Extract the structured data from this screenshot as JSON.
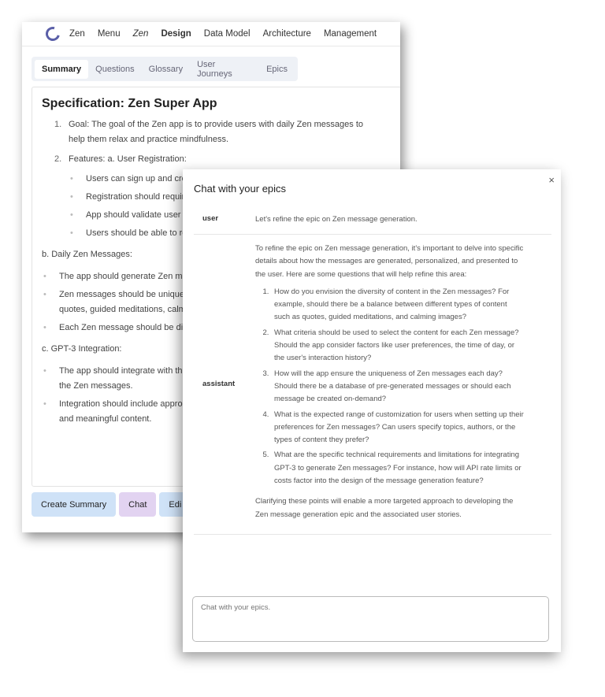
{
  "nav": {
    "items": [
      "Zen",
      "Menu",
      "Zen",
      "Design",
      "Data Model",
      "Architecture",
      "Management"
    ]
  },
  "tabs": [
    "Summary",
    "Questions",
    "Glossary",
    "User Journeys",
    "Epics"
  ],
  "spec": {
    "title": "Specification: Zen Super App",
    "items": [
      {
        "n": "1.",
        "text": "Goal: The goal of the Zen app is to provide users with daily Zen messages to help them relax and practice mindfulness."
      },
      {
        "n": "2.",
        "text": "Features: a. User Registration:"
      }
    ],
    "registration": [
      "Users can sign up and creat",
      "Registration should require email, and password.",
      "App should validate user inp password strength requirem",
      "Users should be able to reco reset process."
    ],
    "daily_heading": "b. Daily Zen Messages:",
    "daily": [
      "The app should generate Zen me",
      "Zen messages should be unique quotes, guided meditations, calm",
      "Each Zen message should be dis"
    ],
    "gpt_heading": "c. GPT-3 Integration:",
    "gpt": [
      "The app should integrate with th the Zen messages.",
      "Integration should include appro and meaningful content."
    ]
  },
  "buttons": {
    "create_summary": "Create Summary",
    "chat": "Chat",
    "edit": "Edi"
  },
  "colors": {
    "blue_button": "#cfe2f7",
    "purple_button": "#e2d3f1"
  },
  "modal": {
    "title": "Chat with your epics",
    "close": "×",
    "messages": [
      {
        "role": "user",
        "text": "Let's refine the epic on Zen message generation."
      },
      {
        "role": "assistant",
        "intro": "To refine the epic on Zen message generation, it's important to delve into specific details about how the messages are generated, personalized, and presented to the user. Here are some questions that will help refine this area:",
        "questions": [
          "How do you envision the diversity of content in the Zen messages? For example, should there be a balance between different types of content such as quotes, guided meditations, and calming images?",
          "What criteria should be used to select the content for each Zen message? Should the app consider factors like user preferences, the time of day, or the user's interaction history?",
          "How will the app ensure the uniqueness of Zen messages each day? Should there be a database of pre-generated messages or should each message be created on-demand?",
          "What is the expected range of customization for users when setting up their preferences for Zen messages? Can users specify topics, authors, or the types of content they prefer?",
          "What are the specific technical requirements and limitations for integrating GPT-3 to generate Zen messages? For instance, how will API rate limits or costs factor into the design of the message generation feature?"
        ],
        "outro": "Clarifying these points will enable a more targeted approach to developing the Zen message generation epic and the associated user stories."
      }
    ],
    "input_placeholder": "Chat with your epics."
  }
}
